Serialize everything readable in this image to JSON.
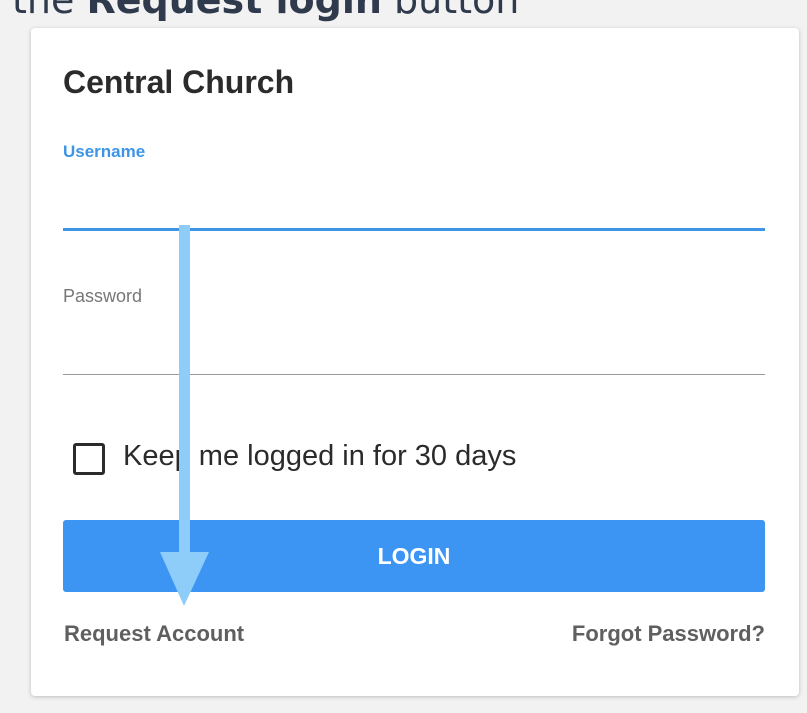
{
  "caption": {
    "prefix": "the ",
    "bold": "Request login",
    "suffix": " button"
  },
  "form": {
    "title": "Central Church",
    "username_label": "Username",
    "username_value": "",
    "password_label": "Password",
    "password_value": "",
    "keep_logged_in_label": "Keep me logged in for 30 days",
    "keep_logged_in_checked": false,
    "login_button": "LOGIN",
    "request_account_link": "Request Account",
    "forgot_password_link": "Forgot Password?"
  },
  "colors": {
    "accent": "#3d95f3",
    "arrow": "#8ecdfa"
  }
}
